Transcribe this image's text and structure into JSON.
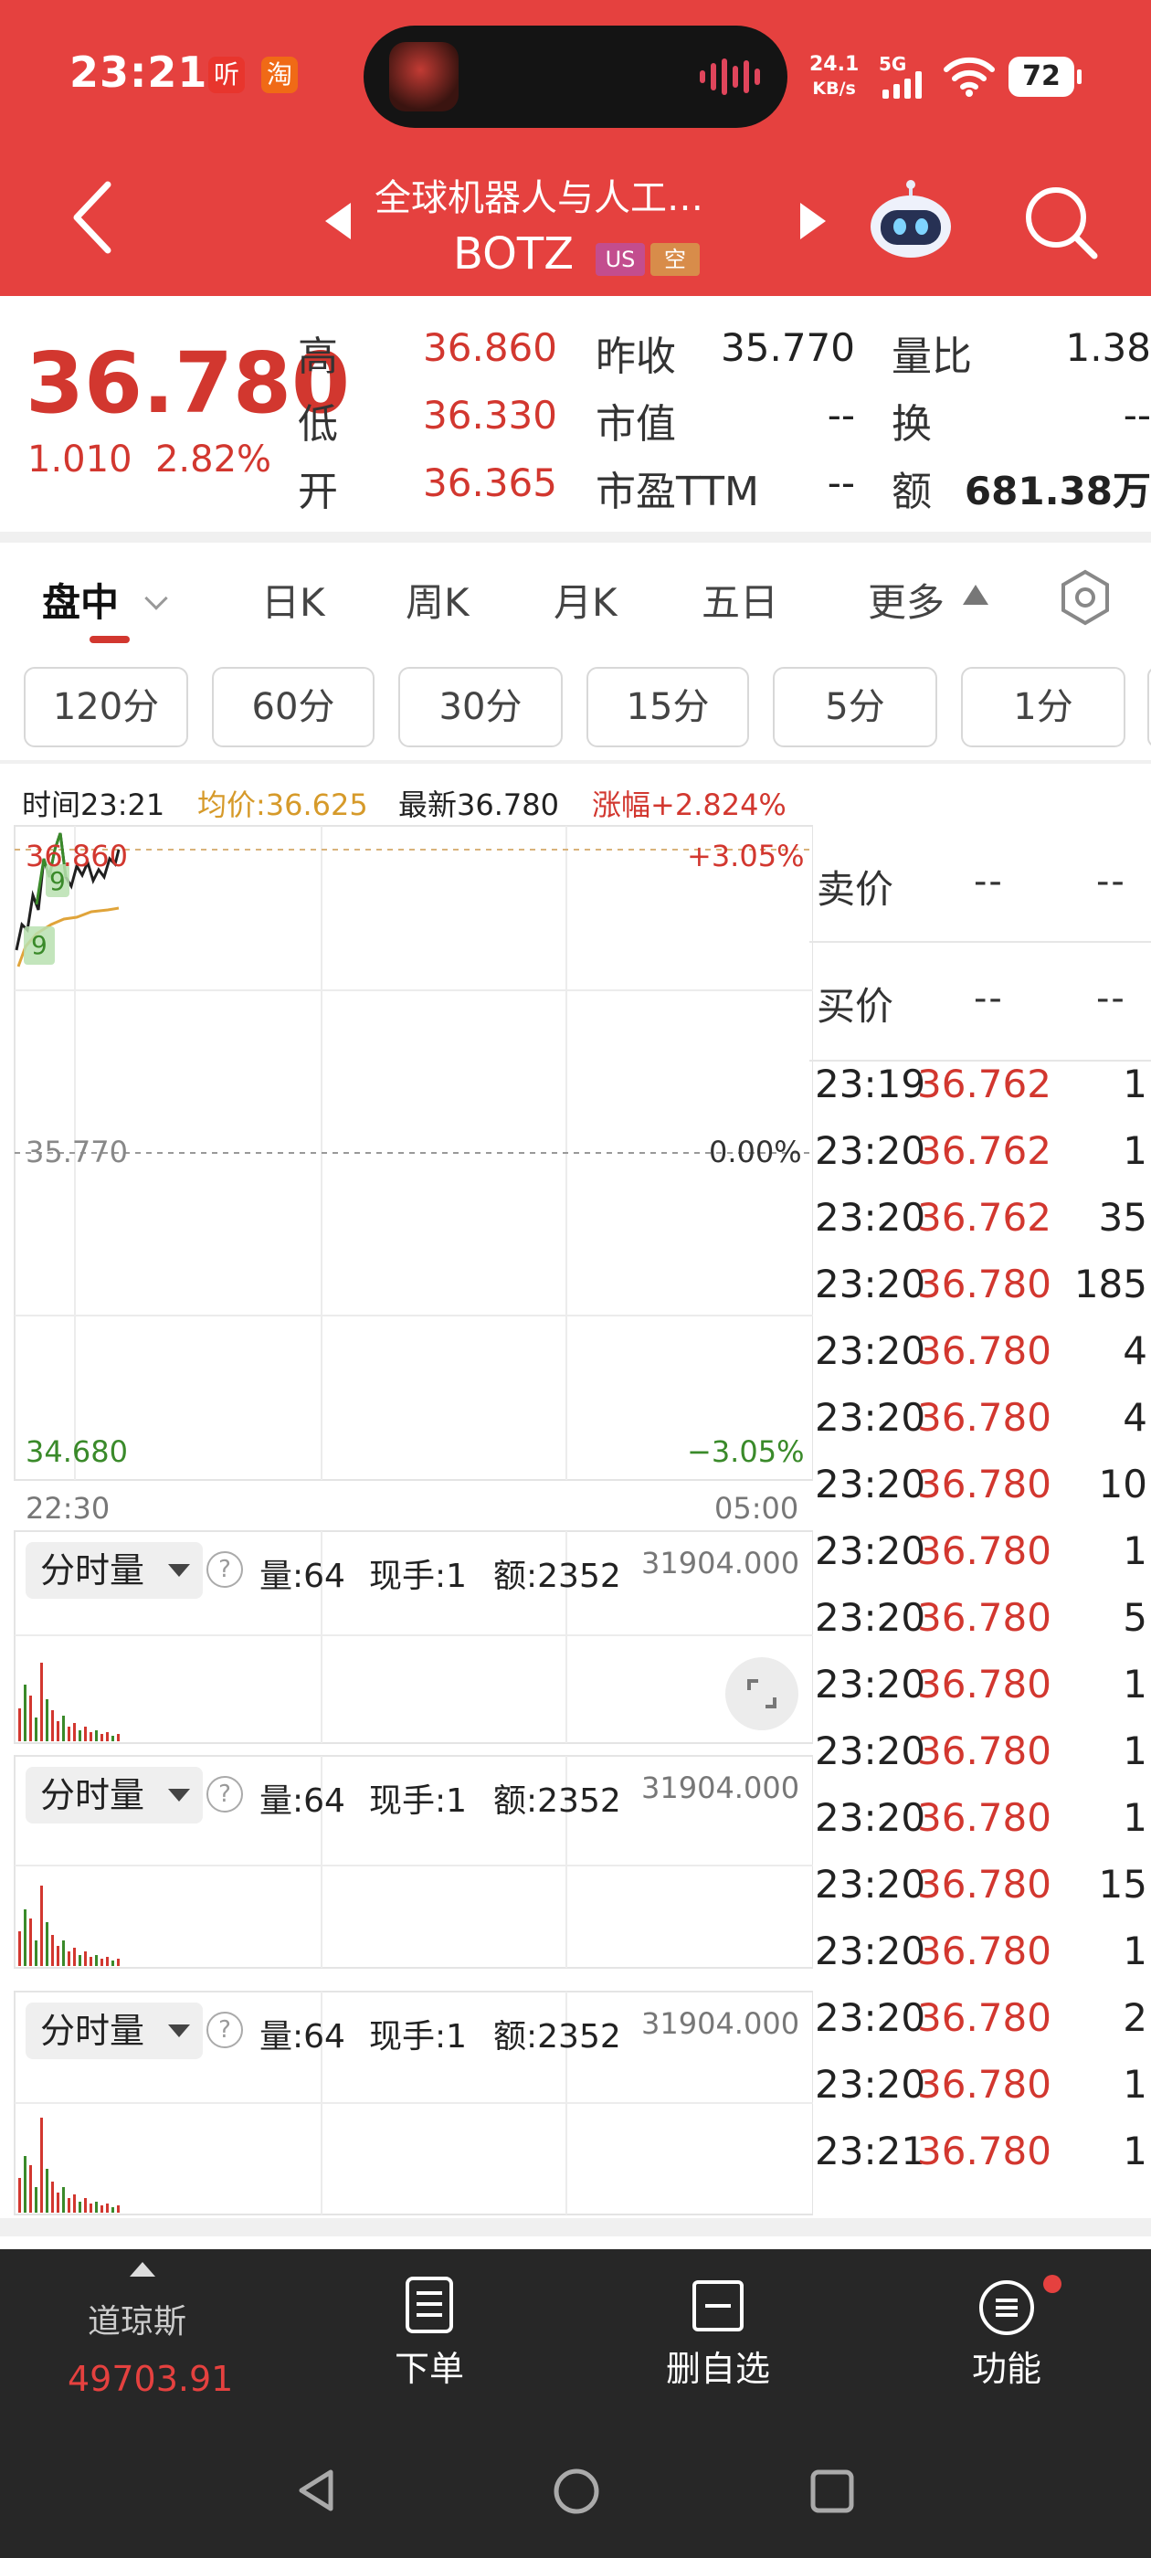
{
  "status_bar": {
    "time": "23:21",
    "app_badge_1": "听",
    "app_badge_2": "淘",
    "net_speed_value": "24.1",
    "net_speed_unit": "KB/s",
    "network": "5G",
    "battery": "72"
  },
  "header": {
    "title": "全球机器人与人工…",
    "symbol": "BOTZ",
    "market_tag": "US",
    "short_tag": "空"
  },
  "quote": {
    "price": "36.780",
    "change": "1.010",
    "change_pct": "2.82%",
    "high_label": "高",
    "high": "36.860",
    "low_label": "低",
    "low": "36.330",
    "open_label": "开",
    "open": "36.365",
    "prev_close_label": "昨收",
    "prev_close": "35.770",
    "market_cap_label": "市值",
    "market_cap": "--",
    "pe_label": "市盈TTM",
    "pe": "--",
    "volume_ratio_label": "量比",
    "volume_ratio": "1.38",
    "turnover_label": "换",
    "turnover": "--",
    "amount_label": "额",
    "amount": "681.38万"
  },
  "period_tabs": {
    "intraday": "盘中",
    "day": "日K",
    "week": "周K",
    "month": "月K",
    "five_day": "五日",
    "more": "更多"
  },
  "minute_buttons": [
    "120分",
    "60分",
    "30分",
    "15分",
    "5分",
    "1分"
  ],
  "info_bar": {
    "time": "时间23:21",
    "avg": "均价:36.625",
    "latest": "最新36.780",
    "change": "涨幅+2.824%"
  },
  "chart": {
    "top_price": "36.860",
    "top_pct": "+3.05%",
    "mid_price": "35.770",
    "mid_pct": "0.00%",
    "low_price": "34.680",
    "low_pct": "−3.05%",
    "start_time": "22:30",
    "end_time": "05:00",
    "marker_high": "9",
    "marker_low": "9"
  },
  "order_book": {
    "ask_label": "卖价",
    "bid_label": "买价",
    "ask_price": "--",
    "ask_qty": "--",
    "bid_price": "--",
    "bid_qty": "--"
  },
  "ticks": [
    {
      "time": "23:19",
      "price": "36.762",
      "vol": "1"
    },
    {
      "time": "23:20",
      "price": "36.762",
      "vol": "1"
    },
    {
      "time": "23:20",
      "price": "36.762",
      "vol": "35"
    },
    {
      "time": "23:20",
      "price": "36.780",
      "vol": "185"
    },
    {
      "time": "23:20",
      "price": "36.780",
      "vol": "4"
    },
    {
      "time": "23:20",
      "price": "36.780",
      "vol": "4"
    },
    {
      "time": "23:20",
      "price": "36.780",
      "vol": "10"
    },
    {
      "time": "23:20",
      "price": "36.780",
      "vol": "1"
    },
    {
      "time": "23:20",
      "price": "36.780",
      "vol": "5"
    },
    {
      "time": "23:20",
      "price": "36.780",
      "vol": "1"
    },
    {
      "time": "23:20",
      "price": "36.780",
      "vol": "1"
    },
    {
      "time": "23:20",
      "price": "36.780",
      "vol": "1"
    },
    {
      "time": "23:20",
      "price": "36.780",
      "vol": "15"
    },
    {
      "time": "23:20",
      "price": "36.780",
      "vol": "1"
    },
    {
      "time": "23:20",
      "price": "36.780",
      "vol": "2"
    },
    {
      "time": "23:20",
      "price": "36.780",
      "vol": "1"
    },
    {
      "time": "23:21",
      "price": "36.780",
      "vol": "1"
    }
  ],
  "volume_panels": [
    {
      "dropdown": "分时量",
      "volume": "量:64",
      "last_hand": "现手:1",
      "amount": "额:2352",
      "max": "31904.000"
    },
    {
      "dropdown": "分时量",
      "volume": "量:64",
      "last_hand": "现手:1",
      "amount": "额:2352",
      "max": "31904.000"
    },
    {
      "dropdown": "分时量",
      "volume": "量:64",
      "last_hand": "现手:1",
      "amount": "额:2352",
      "max": "31904.000"
    }
  ],
  "bottom_nav": {
    "index_name": "道琼斯",
    "index_value": "49703.91",
    "order": "下单",
    "remove_watch": "删自选",
    "functions": "功能"
  },
  "colors": {
    "header_bg": "#e5413f",
    "up": "#d2372f",
    "down": "#3a8a2a",
    "avg_line": "#e0a43a",
    "nav_bg": "#272727"
  }
}
